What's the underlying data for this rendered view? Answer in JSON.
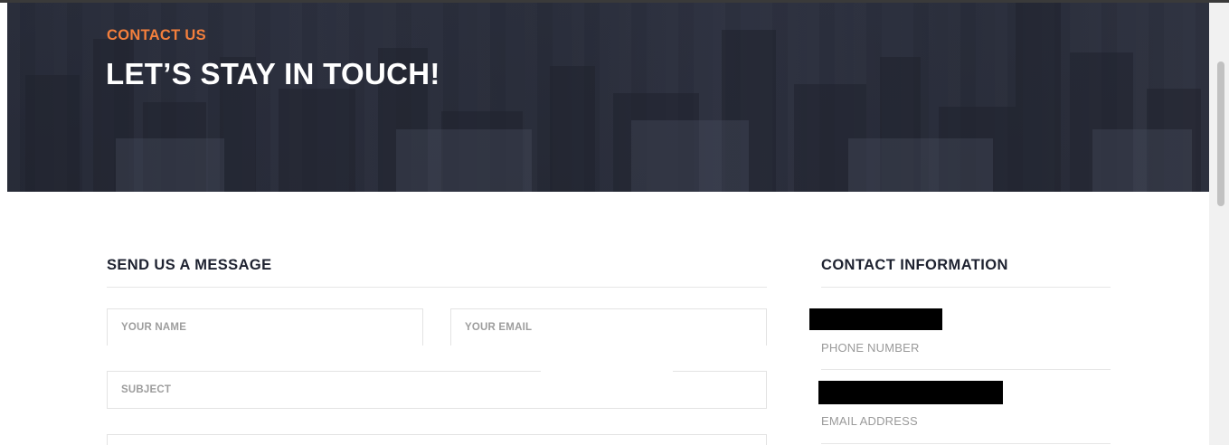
{
  "hero": {
    "kicker": "CONTACT US",
    "title": "LET’S STAY IN TOUCH!"
  },
  "form": {
    "heading": "SEND US A MESSAGE",
    "name_placeholder": "YOUR NAME",
    "email_placeholder": "YOUR EMAIL",
    "subject_placeholder": "SUBJECT"
  },
  "contact_info": {
    "heading": "CONTACT INFORMATION",
    "phone_label": "PHONE NUMBER",
    "email_label": "EMAIL ADDRESS"
  },
  "colors": {
    "accent": "#f47f3c",
    "heading": "#1e2230",
    "hero_bg": "#2b2f3c"
  }
}
